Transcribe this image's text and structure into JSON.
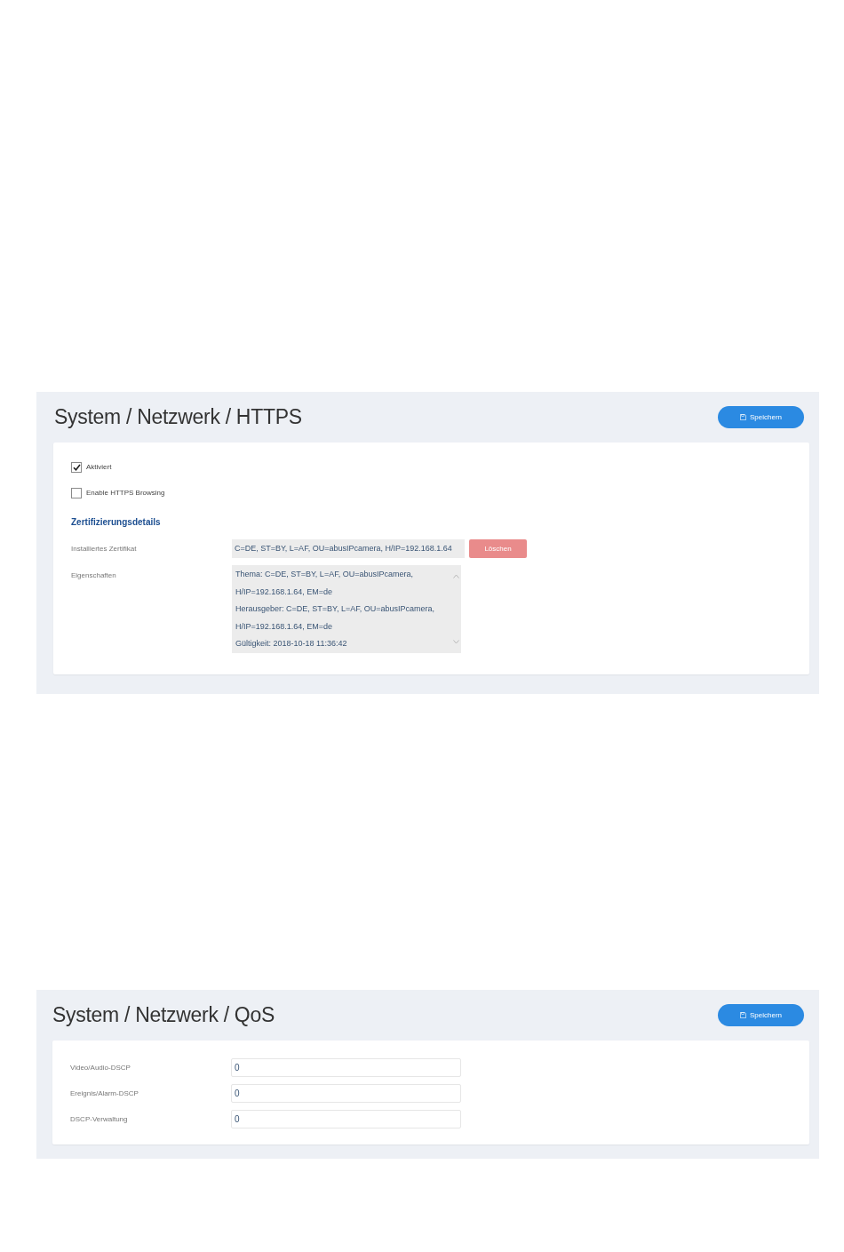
{
  "panels": [
    {
      "title": "System / Netzwerk / HTTPS",
      "save_button": "Speichern",
      "rows": [
        {
          "kind": "checkbox",
          "label": "Aktiviert",
          "checked": true
        },
        {
          "kind": "checkbox",
          "label": "Enable HTTPS Browsing",
          "checked": false
        },
        {
          "kind": "heading",
          "label": "Zertifizierungsdetails"
        },
        {
          "kind": "readonly",
          "label": "Installiertes Zertifikat",
          "value": "C=DE, ST=BY, L=AF, OU=abusIPcamera, H/IP=192.168.1.64",
          "button": "Löschen"
        },
        {
          "kind": "textarea",
          "label": "Eigenschaften",
          "lines": [
            "Thema: C=DE, ST=BY, L=AF, OU=abusIPcamera,",
            "H/IP=192.168.1.64, EM=de",
            "Herausgeber: C=DE, ST=BY, L=AF, OU=abusIPcamera,",
            "H/IP=192.168.1.64, EM=de",
            "Gültigkeit: 2018-10-18 11:36:42"
          ]
        }
      ]
    },
    {
      "title": "System / Netzwerk / QoS",
      "save_button": "Speichern",
      "rows": [
        {
          "kind": "input",
          "label": "Video/Audio-DSCP",
          "value": "0"
        },
        {
          "kind": "input",
          "label": "Ereignis/Alarm-DSCP",
          "value": "0"
        },
        {
          "kind": "input",
          "label": "DSCP-Verwaltung",
          "value": "0"
        }
      ]
    }
  ]
}
